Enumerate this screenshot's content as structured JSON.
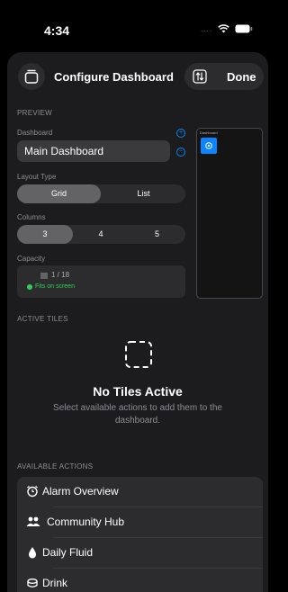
{
  "status": {
    "time": "4:34",
    "signal_dots": "....",
    "wifi_icon": "wifi-icon",
    "battery_icon": "battery-icon"
  },
  "header": {
    "title": "Configure Dashboard",
    "done_label": "Done",
    "left_icon": "dashboard-icon",
    "swap_icon": "swap-icon"
  },
  "preview_section": {
    "heading": "PREVIEW",
    "dashboard_label": "Dashboard",
    "dashboard_value": "Main Dashboard",
    "layout_label": "Layout Type",
    "layout_options": [
      "Grid",
      "List"
    ],
    "layout_selected": "Grid",
    "columns_label": "Columns",
    "columns_options": [
      "3",
      "4",
      "5"
    ],
    "columns_selected": "3",
    "capacity_label": "Capacity",
    "capacity_count": "1 / 18",
    "capacity_status": "Fits on screen",
    "preview_title": "Dashboard"
  },
  "active_section": {
    "heading": "ACTIVE TILES",
    "empty_title": "No Tiles Active",
    "empty_body": "Select available actions to add them to the dashboard."
  },
  "available_section": {
    "heading": "AVAILABLE ACTIONS",
    "items": [
      {
        "label": "Alarm Overview",
        "icon": "alarm-clock-icon"
      },
      {
        "label": "Community Hub",
        "icon": "people-icon"
      },
      {
        "label": "Daily Fluid",
        "icon": "drop-icon"
      },
      {
        "label": "Drink",
        "icon": "cup-icon"
      }
    ]
  },
  "colors": {
    "accent": "#0a84ff",
    "success": "#30d158",
    "sheet": "#1c1c1e",
    "control": "#2c2c2e"
  }
}
